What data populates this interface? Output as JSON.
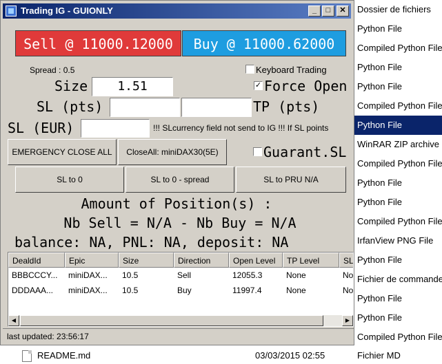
{
  "background_list": {
    "items": [
      {
        "label": "Dossier de fichiers",
        "selected": false
      },
      {
        "label": "Python File",
        "selected": false
      },
      {
        "label": "Compiled Python File",
        "selected": false
      },
      {
        "label": "Python File",
        "selected": false
      },
      {
        "label": "Python File",
        "selected": false
      },
      {
        "label": "Compiled Python File",
        "selected": false
      },
      {
        "label": "Python File",
        "selected": true
      },
      {
        "label": "WinRAR ZIP archive",
        "selected": false
      },
      {
        "label": "Compiled Python File",
        "selected": false
      },
      {
        "label": "Python File",
        "selected": false
      },
      {
        "label": "Python File",
        "selected": false
      },
      {
        "label": "Compiled Python File",
        "selected": false
      },
      {
        "label": "IrfanView PNG File",
        "selected": false
      },
      {
        "label": "Python File",
        "selected": false
      },
      {
        "label": "Fichier de commandes",
        "selected": false
      },
      {
        "label": "Python File",
        "selected": false
      },
      {
        "label": "Python File",
        "selected": false
      },
      {
        "label": "Compiled Python File",
        "selected": false
      }
    ],
    "readme": {
      "name": "README.md",
      "date": "03/03/2015 02:55",
      "type": "Fichier MD",
      "icon": "document-icon"
    }
  },
  "window": {
    "title": "Trading IG - GUIONLY",
    "controls": {
      "minimize": "_",
      "maximize": "□",
      "close": "✕"
    },
    "sell_button": "Sell @ 11000.12000",
    "buy_button": "Buy @ 11000.62000",
    "spread": "Spread : 0.5",
    "keyboard_trading_label": "Keyboard Trading",
    "keyboard_trading_checked": false,
    "size_label": "Size",
    "size_value": "1.51",
    "force_open_label": "Force Open",
    "force_open_checked": true,
    "sl_pts_label": "SL (pts)",
    "sl_pts_value": "",
    "tp_pts_value": "",
    "tp_pts_label": "TP (pts)",
    "sl_eur_label": "SL (EUR)",
    "sl_eur_value": "",
    "sl_warning": "!!! SLcurrency field not send to IG !!! If SL points",
    "emergency_button": "EMERGENCY CLOSE ALL",
    "closeall_button": "CloseAll: miniDAX30(5E)",
    "guarant_label": "Guarant.SL",
    "guarant_checked": false,
    "sl_to_zero": "SL to 0",
    "sl_to_zero_spread": "SL to 0 - spread",
    "sl_to_pru": "SL to PRU   N/A",
    "amount_label": "Amount of Position(s) :",
    "nb_line": "Nb Sell = N/A - Nb Buy = N/A",
    "balance_line": "balance: NA, PNL: NA, deposit: NA",
    "positions": {
      "columns": [
        "DealdId",
        "Epic",
        "Size",
        "Direction",
        "Open Level",
        "TP Level",
        "SL"
      ],
      "rows": [
        [
          "BBBCCCY...",
          "miniDAX...",
          "10.5",
          "Sell",
          "12055.3",
          "None",
          "No"
        ],
        [
          "DDDAAA...",
          "miniDAX...",
          "10.5",
          "Buy",
          "11997.4",
          "None",
          "No"
        ]
      ]
    },
    "status": "last updated: 23:56:17"
  }
}
